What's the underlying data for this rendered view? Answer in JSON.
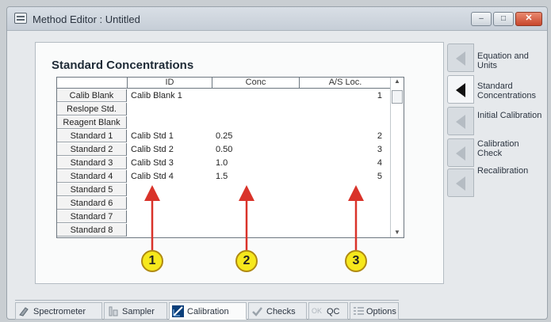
{
  "window": {
    "title": "Method Editor : Untitled",
    "buttons": {
      "minimize": "–",
      "maximize": "□",
      "close": "✕"
    }
  },
  "section": {
    "title": "Standard Concentrations"
  },
  "table": {
    "columns": [
      "ID",
      "Conc",
      "A/S Loc."
    ],
    "rows": [
      {
        "label": "Calib Blank",
        "id": "Calib Blank 1",
        "conc": "",
        "loc": "1"
      },
      {
        "label": "Reslope Std.",
        "id": "",
        "conc": "",
        "loc": ""
      },
      {
        "label": "Reagent Blank",
        "id": "",
        "conc": "",
        "loc": ""
      },
      {
        "label": "Standard 1",
        "id": "Calib Std 1",
        "conc": "0.25",
        "loc": "2"
      },
      {
        "label": "Standard 2",
        "id": "Calib Std 2",
        "conc": "0.50",
        "loc": "3"
      },
      {
        "label": "Standard 3",
        "id": "Calib Std 3",
        "conc": "1.0",
        "loc": "4"
      },
      {
        "label": "Standard 4",
        "id": "Calib Std 4",
        "conc": "1.5",
        "loc": "5"
      },
      {
        "label": "Standard 5",
        "id": "",
        "conc": "",
        "loc": ""
      },
      {
        "label": "Standard 6",
        "id": "",
        "conc": "",
        "loc": ""
      },
      {
        "label": "Standard 7",
        "id": "",
        "conc": "",
        "loc": ""
      },
      {
        "label": "Standard 8",
        "id": "",
        "conc": "",
        "loc": ""
      }
    ]
  },
  "callouts": [
    "1",
    "2",
    "3"
  ],
  "side_tabs": [
    {
      "label": "Equation and Units",
      "active": false
    },
    {
      "label": "Standard Concentrations",
      "active": true
    },
    {
      "label": "Initial Calibration",
      "active": false
    },
    {
      "label": "Calibration Check",
      "active": false
    },
    {
      "label": "Recalibration",
      "active": false
    }
  ],
  "bottom_tabs": [
    {
      "label": "Spectrometer",
      "icon": "spectrometer-icon"
    },
    {
      "label": "Sampler",
      "icon": "sampler-icon"
    },
    {
      "label": "Calibration",
      "icon": "calibration-icon",
      "active": true
    },
    {
      "label": "Checks",
      "icon": "checks-icon"
    },
    {
      "label": "QC",
      "icon": "qc-icon",
      "dim_prefix": "OK"
    },
    {
      "label": "Options",
      "icon": "options-icon"
    }
  ],
  "colors": {
    "arrow": "#d9332a",
    "callout_fill": "#f6e81c"
  }
}
